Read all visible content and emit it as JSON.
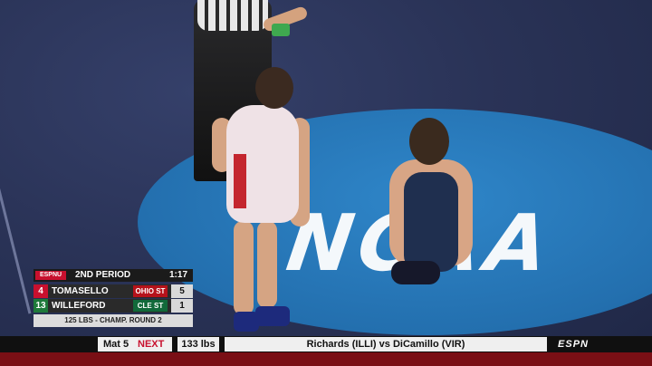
{
  "scene": {
    "mat_logo": "NCAA"
  },
  "scorebug": {
    "network": "ESPNU",
    "period": "2ND PERIOD",
    "clock": "1:17",
    "wrestlers": [
      {
        "seed": "4",
        "name": "TOMASELLO",
        "school": "OHIO ST",
        "score": "5",
        "color": "#c8102e"
      },
      {
        "seed": "13",
        "name": "WILLEFORD",
        "school": "CLE ST",
        "score": "1",
        "color": "#1e7a3a"
      }
    ],
    "round_info": "125 LBS - CHAMP. ROUND 2"
  },
  "ticker": {
    "mat_label": "Mat 5",
    "next_label": "NEXT",
    "weight": "133 lbs",
    "matchup": "Richards (ILLI) vs DiCamillo (VIR)",
    "network_logo": "ESPN"
  }
}
